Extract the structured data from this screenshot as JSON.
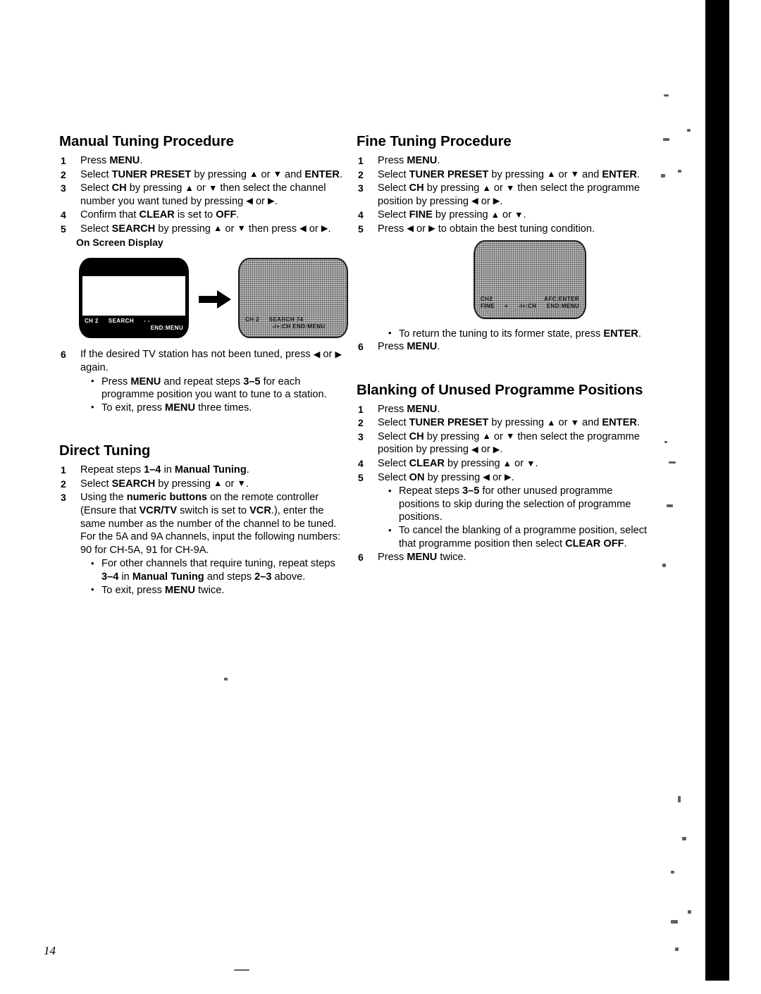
{
  "page": {
    "number": "14"
  },
  "left_column": {
    "manual_tuning": {
      "heading": "Manual Tuning Procedure",
      "steps": [
        {
          "num": "1",
          "html": "Press <b>MENU</b>."
        },
        {
          "num": "2",
          "html": "Select <b>TUNER PRESET</b> by pressing <span class=\"ar\">&#9650;</span> or <span class=\"ar\">&#9660;</span> and <b>ENTER</b>."
        },
        {
          "num": "3",
          "html": "Select <b>CH</b> by pressing <span class=\"ar\">&#9650;</span> or <span class=\"ar\">&#9660;</span> then select the channel number you want tuned by pressing <span class=\"ar\">&#9664;</span> or <span class=\"ar\">&#9654;</span>."
        },
        {
          "num": "4",
          "html": "Confirm that <b>CLEAR</b> is set to <b>OFF</b>."
        },
        {
          "num": "5",
          "html": "Select <b>SEARCH</b> by pressing <span class=\"ar\">&#9650;</span> or <span class=\"ar\">&#9660;</span> then press <span class=\"ar\">&#9664;</span> or <span class=\"ar\">&#9654;</span>."
        }
      ],
      "osd_label": "On Screen Display",
      "screens": [
        {
          "name": "before",
          "channel": "CH 2",
          "mode": "SEARCH",
          "value": "- -",
          "footer": "END:MENU"
        },
        {
          "name": "after",
          "channel": "CH 2",
          "mode": "SEARCH 74",
          "value": "",
          "footer": "-/+:CH  END:MENU"
        }
      ],
      "steps_after": [
        {
          "num": "6",
          "html": "If the desired TV station has not been tuned, press <span class=\"ar\">&#9664;</span> or <span class=\"ar\">&#9654;</span> again."
        }
      ],
      "bullets": [
        "Press <b>MENU</b> and repeat steps <b>3&#8211;5</b> for each programme position you want to tune to a station.",
        "To exit, press <b>MENU</b> three times."
      ]
    },
    "direct_tuning": {
      "heading": "Direct Tuning",
      "steps": [
        {
          "num": "1",
          "html": "Repeat steps <b>1&#8211;4</b> in <b>Manual Tuning</b>."
        },
        {
          "num": "2",
          "html": "Select <b>SEARCH</b> by pressing <span class=\"ar\">&#9650;</span> or <span class=\"ar\">&#9660;</span>."
        },
        {
          "num": "3",
          "html": "Using the <b>numeric buttons</b> on the remote controller (Ensure that <b>VCR/TV</b> switch is set to <b>VCR</b>.), enter the same number as the number of the channel to be tuned. For the 5A and 9A channels, input the following numbers: 90 for CH-5A, 91 for CH-9A."
        }
      ],
      "bullets": [
        "For other channels that require tuning, repeat steps <b>3&#8211;4</b> in <b>Manual Tuning</b> and steps <b>2&#8211;3</b> above.",
        "To exit, press <b>MENU</b> twice."
      ]
    }
  },
  "right_column": {
    "fine_tuning": {
      "heading": "Fine Tuning Procedure",
      "steps": [
        {
          "num": "1",
          "html": "Press <b>MENU</b>."
        },
        {
          "num": "2",
          "html": "Select <b>TUNER PRESET</b> by pressing <span class=\"ar\">&#9650;</span> or <span class=\"ar\">&#9660;</span> and <b>ENTER</b>."
        },
        {
          "num": "3",
          "html": "Select <b>CH</b> by pressing <span class=\"ar\">&#9650;</span> or <span class=\"ar\">&#9660;</span> then select the programme position by pressing <span class=\"ar\">&#9664;</span> or <span class=\"ar\">&#9654;</span>."
        },
        {
          "num": "4",
          "html": "Select <b>FINE</b> by pressing <span class=\"ar\">&#9650;</span> or <span class=\"ar\">&#9660;</span>."
        },
        {
          "num": "5",
          "html": "Press <span class=\"ar\">&#9664;</span> or <span class=\"ar\">&#9654;</span> to obtain the best tuning condition."
        }
      ],
      "screen": {
        "channel": "CH2",
        "mode": "FINE",
        "level": "+",
        "hint": "-/+:CH",
        "top_right": "AFC:ENTER",
        "footer": "END:MENU"
      },
      "bullets": [
        "To return the tuning to its former state, press <b>ENTER</b>."
      ],
      "steps_after": [
        {
          "num": "6",
          "html": "Press <b>MENU</b>."
        }
      ]
    },
    "blanking": {
      "heading": "Blanking of Unused Programme Positions",
      "steps": [
        {
          "num": "1",
          "html": "Press <b>MENU</b>."
        },
        {
          "num": "2",
          "html": "Select <b>TUNER PRESET</b> by pressing <span class=\"ar\">&#9650;</span> or <span class=\"ar\">&#9660;</span> and <b>ENTER</b>."
        },
        {
          "num": "3",
          "html": "Select <b>CH</b> by pressing <span class=\"ar\">&#9650;</span> or <span class=\"ar\">&#9660;</span> then select the programme position by pressing <span class=\"ar\">&#9664;</span> or <span class=\"ar\">&#9654;</span>."
        },
        {
          "num": "4",
          "html": "Select <b>CLEAR</b> by pressing <span class=\"ar\">&#9650;</span> or <span class=\"ar\">&#9660;</span>."
        },
        {
          "num": "5",
          "html": "Select <b>ON</b> by pressing <span class=\"ar\">&#9664;</span> or <span class=\"ar\">&#9654;</span>."
        }
      ],
      "bullets": [
        "Repeat steps <b>3&#8211;5</b> for other unused programme positions to skip during the selection of programme positions.",
        "To cancel the blanking of a programme position, select that programme position then select <b>CLEAR OFF</b>."
      ],
      "steps_after": [
        {
          "num": "6",
          "html": "Press <b>MENU</b> twice."
        }
      ]
    }
  }
}
